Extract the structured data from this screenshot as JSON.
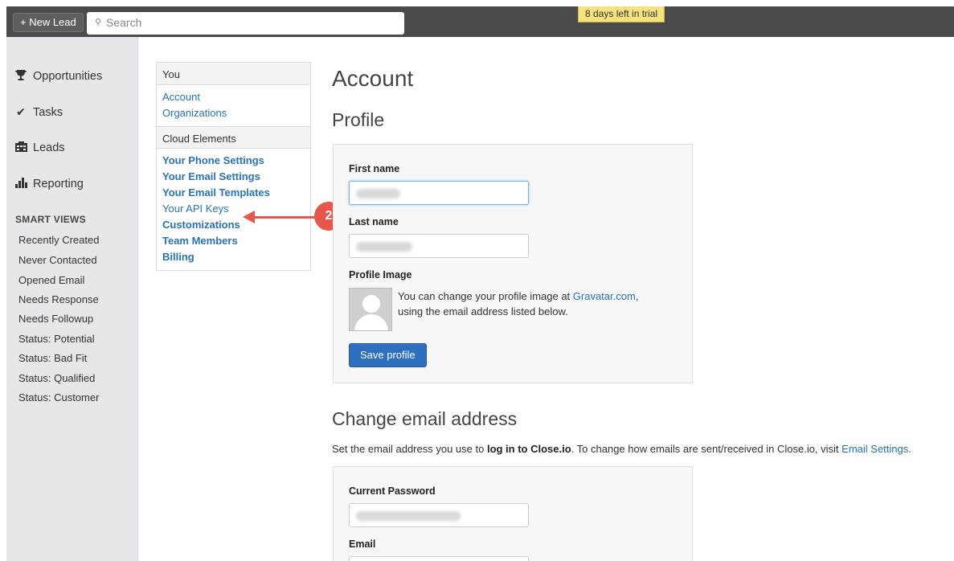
{
  "topbar": {
    "new_lead_label": "+ New Lead",
    "search_placeholder": "Search",
    "trial_text": "8 days left in trial"
  },
  "sidebar": {
    "nav": [
      {
        "label": "Opportunities",
        "icon": "trophy-icon"
      },
      {
        "label": "Tasks",
        "icon": "checkmark-icon"
      },
      {
        "label": "Leads",
        "icon": "building-icon"
      },
      {
        "label": "Reporting",
        "icon": "bar-chart-icon"
      }
    ],
    "smart_views_title": "SMART VIEWS",
    "smart_views": [
      "Recently Created",
      "Never Contacted",
      "Opened Email",
      "Needs Response",
      "Needs Followup",
      "Status: Potential",
      "Status: Bad Fit",
      "Status: Qualified",
      "Status: Customer"
    ]
  },
  "settings_menu": {
    "you_header": "You",
    "you_links": [
      "Account",
      "Organizations"
    ],
    "org_header": "Cloud Elements",
    "org_links": [
      "Your Phone Settings",
      "Your Email Settings",
      "Your Email Templates",
      "Your API Keys",
      "Customizations",
      "Team Members",
      "Billing"
    ]
  },
  "annotation": {
    "badge": "2"
  },
  "main": {
    "title": "Account",
    "profile_heading": "Profile",
    "first_name_label": "First name",
    "last_name_label": "Last name",
    "profile_image_label": "Profile Image",
    "gravatar_text_1": "You can change your profile image at ",
    "gravatar_link": "Gravatar.com",
    "gravatar_text_2": ",",
    "gravatar_text_3": "using the email address listed below.",
    "save_profile_label": "Save profile",
    "change_email_heading": "Change email address",
    "email_desc_1": "Set the email address you use to ",
    "email_desc_bold": "log in to Close.io",
    "email_desc_2": ". To change how emails are sent/received in Close.io, visit ",
    "email_desc_link": "Email Settings",
    "email_desc_3": ".",
    "current_password_label": "Current Password",
    "email_label": "Email"
  },
  "colors": {
    "accent_link": "#2a73b8",
    "primary_button": "#2f6fc0",
    "annotation": "#e8554a",
    "trial_badge": "#f6e27f"
  }
}
